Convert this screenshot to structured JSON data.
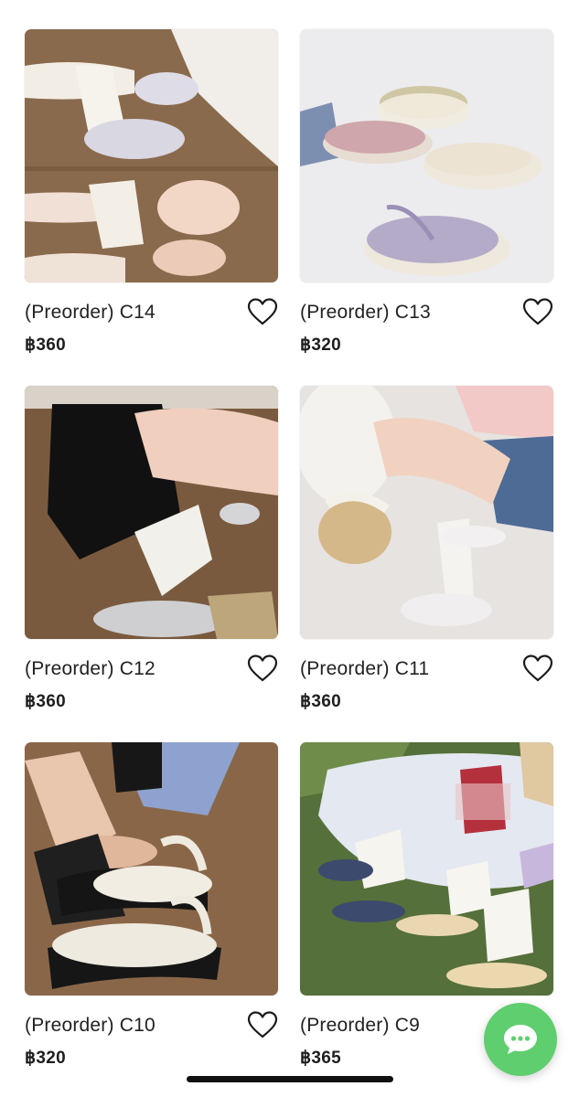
{
  "products": [
    {
      "title": "(Preorder) C14",
      "price": "฿360",
      "image": "satin-mary-jane-shoes-with-ribbon-socks"
    },
    {
      "title": "(Preorder) C13",
      "price": "฿320",
      "image": "platform-flip-flop-sandals"
    },
    {
      "title": "(Preorder) C12",
      "price": "฿360",
      "image": "silver-mary-jane-flats"
    },
    {
      "title": "(Preorder) C11",
      "price": "฿360",
      "image": "white-mary-jane-flats"
    },
    {
      "title": "(Preorder) C10",
      "price": "฿320",
      "image": "chunky-platform-sandals"
    },
    {
      "title": "(Preorder) C9",
      "price": "฿365",
      "image": "gingham-slingback-heels"
    }
  ],
  "icons": {
    "favorite": "heart-icon",
    "chat": "chat-bubble-icon"
  },
  "colors": {
    "chat_button": "#5fce6e",
    "text": "#1b1b1b"
  }
}
